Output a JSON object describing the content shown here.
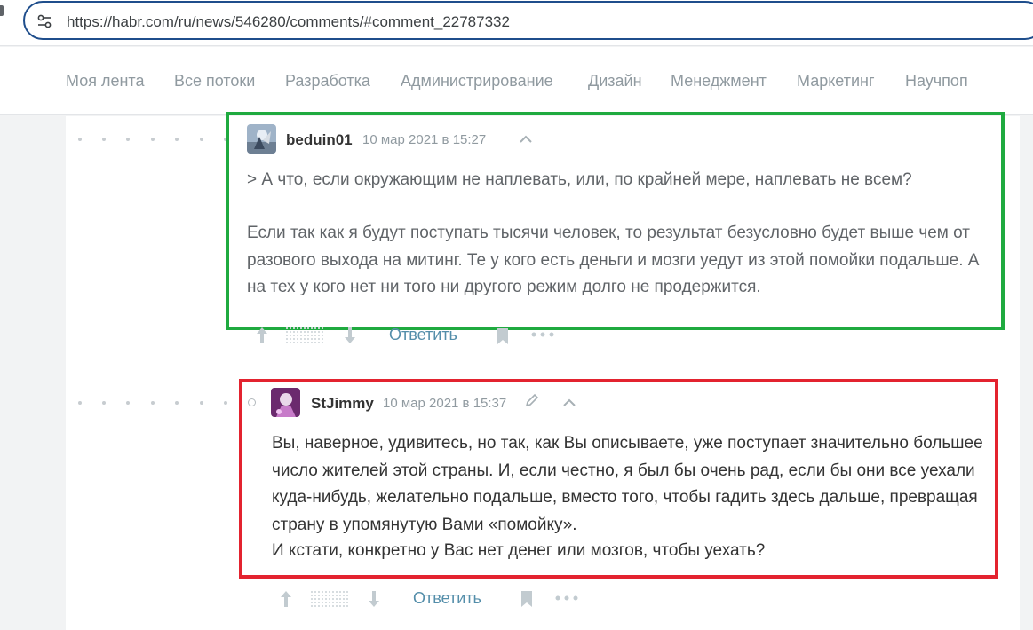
{
  "browser": {
    "url": "https://habr.com/ru/news/546280/comments/#comment_22787332",
    "site_info_icon": "tune-icon"
  },
  "nav": {
    "items": [
      "Моя лента",
      "Все потоки",
      "Разработка",
      "Администрирование",
      "Дизайн",
      "Менеджмент",
      "Маркетинг",
      "Научпоп"
    ]
  },
  "comments": [
    {
      "author": "beduin01",
      "date": "10 мар 2021 в 15:27",
      "quote": "> А что, если окружающим не наплевать, или, по крайней мере, наплевать не всем?",
      "body": "Если так как я будут поступать тысячи человек, то результат безусловно будет выше чем от разового выхода на митинг. Те у кого есть деньги и мозги уедут из этой помойки подальше. А на тех у кого нет ни того ни другого режим долго не продержится.",
      "reply_label": "Ответить",
      "highlight_color": "#1faa3f"
    },
    {
      "author": "StJimmy",
      "date": "10 мар 2021 в 15:37",
      "body": "Вы, наверное, удивитесь, но так, как Вы описываете, уже поступает значительно большее число жителей этой страны. И, если честно, я был бы очень рад, если бы они все уехали куда-нибудь, желательно подальше, вместо того, чтобы гадить здесь дальше, превращая страну в упомянутую Вами «помойку».",
      "body2": "И кстати, конкретно у Вас нет денег или мозгов, чтобы уехать?",
      "reply_label": "Ответить",
      "highlight_color": "#e3232f"
    }
  ],
  "colors": {
    "accent": "#548eaa",
    "muted": "#909aa0"
  }
}
